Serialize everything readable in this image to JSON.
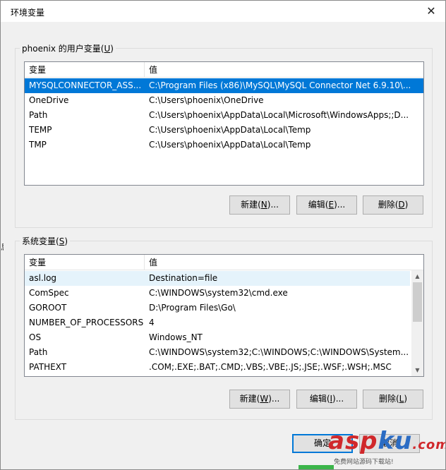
{
  "window": {
    "title": "环境变量",
    "close_glyph": "✕"
  },
  "edge_mark": "息",
  "user_vars": {
    "group_label_prefix": "phoenix 的用户变量(",
    "group_label_key": "U",
    "group_label_suffix": ")",
    "columns": [
      "变量",
      "值"
    ],
    "rows": [
      {
        "name": "MYSQLCONNECTOR_ASS...",
        "value": "C:\\Program Files (x86)\\MySQL\\MySQL Connector Net 6.9.10\\...",
        "selected": true
      },
      {
        "name": "OneDrive",
        "value": "C:\\Users\\phoenix\\OneDrive"
      },
      {
        "name": "Path",
        "value": "C:\\Users\\phoenix\\AppData\\Local\\Microsoft\\WindowsApps;;D..."
      },
      {
        "name": "TEMP",
        "value": "C:\\Users\\phoenix\\AppData\\Local\\Temp"
      },
      {
        "name": "TMP",
        "value": "C:\\Users\\phoenix\\AppData\\Local\\Temp"
      }
    ],
    "buttons": {
      "new": {
        "prefix": "新建(",
        "key": "N",
        "suffix": ")..."
      },
      "edit": {
        "prefix": "编辑(",
        "key": "E",
        "suffix": ")..."
      },
      "delete": {
        "prefix": "删除(",
        "key": "D",
        "suffix": ")"
      }
    }
  },
  "system_vars": {
    "group_label_prefix": "系统变量(",
    "group_label_key": "S",
    "group_label_suffix": ")",
    "columns": [
      "变量",
      "值"
    ],
    "rows": [
      {
        "name": "asl.log",
        "value": "Destination=file",
        "hover": true
      },
      {
        "name": "ComSpec",
        "value": "C:\\WINDOWS\\system32\\cmd.exe"
      },
      {
        "name": "GOROOT",
        "value": "D:\\Program Files\\Go\\"
      },
      {
        "name": "NUMBER_OF_PROCESSORS",
        "value": "4"
      },
      {
        "name": "OS",
        "value": "Windows_NT"
      },
      {
        "name": "Path",
        "value": "C:\\WINDOWS\\system32;C:\\WINDOWS;C:\\WINDOWS\\System..."
      },
      {
        "name": "PATHEXT",
        "value": ".COM;.EXE;.BAT;.CMD;.VBS;.VBE;.JS;.JSE;.WSF;.WSH;.MSC"
      }
    ],
    "buttons": {
      "new": {
        "prefix": "新建(",
        "key": "W",
        "suffix": ")..."
      },
      "edit": {
        "prefix": "编辑(",
        "key": "I",
        "suffix": ")..."
      },
      "delete": {
        "prefix": "删除(",
        "key": "L",
        "suffix": ")"
      }
    }
  },
  "dialog_buttons": {
    "ok": "确定",
    "cancel": "取消"
  },
  "watermark": {
    "brand_a": "asp",
    "brand_b": "ku",
    "brand_c": ".com",
    "subtitle": "免费网站源码下载站!"
  },
  "colors": {
    "selection": "#0078d7",
    "hover": "#e5f3fb",
    "primary_border": "#0078d7"
  },
  "icons": {
    "close": "close-icon",
    "scroll_up": "chevron-up-icon",
    "scroll_down": "chevron-down-icon"
  }
}
